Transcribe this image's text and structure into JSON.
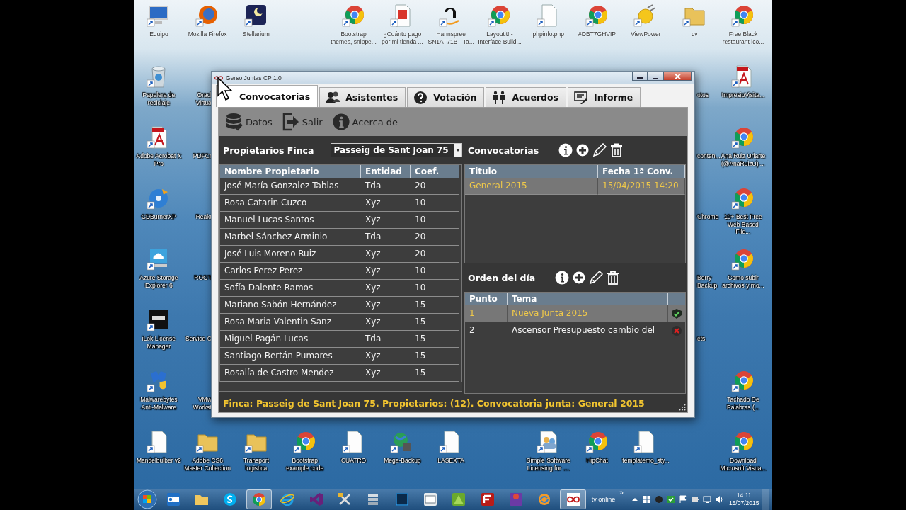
{
  "desktop": {
    "top_row": [
      {
        "label": "Equipo",
        "kind": "computer"
      },
      {
        "label": "Mozilla Firefox",
        "kind": "firefox"
      },
      {
        "label": "Stellarium",
        "kind": "night-tile"
      },
      {
        "label": "Bootstrap themes, snippe...",
        "kind": "chrome"
      },
      {
        "label": "¿Cuánto pago por mi tienda ...",
        "kind": "e-page"
      },
      {
        "label": "Hannspree SN1AT71B - Ta...",
        "kind": "amazon"
      },
      {
        "label": "Layoutit! - Interface Build...",
        "kind": "chrome"
      },
      {
        "label": "phpinfo.php",
        "kind": "page"
      },
      {
        "label": "#DBT7GHVIP",
        "kind": "chrome"
      },
      {
        "label": "ViewPower",
        "kind": "plug"
      },
      {
        "label": "cv",
        "kind": "folder"
      },
      {
        "label": "Free Black restaurant ico...",
        "kind": "chrome"
      }
    ],
    "left_column": [
      {
        "label": "Papelera de reciclaje",
        "kind": "recycle"
      },
      {
        "label": "Adobe Acrobat X Pro",
        "kind": "pdf"
      },
      {
        "label": "CDBurnerXP",
        "kind": "disc"
      },
      {
        "label": "Azure Storage Explorer 6",
        "kind": "cloud"
      },
      {
        "label": "iLok License Manager",
        "kind": "dark-tile"
      },
      {
        "label": "Malwarebytes Anti-Malware",
        "kind": "shield"
      }
    ],
    "right_column": [
      {
        "label": "ImpresioVisita...",
        "kind": "pdf"
      },
      {
        "label": "Ana Ruiz Uriarte (@AnaRuizU) ...",
        "kind": "chrome"
      },
      {
        "label": "10+ Best Free Web Based File...",
        "kind": "chrome"
      },
      {
        "label": "Como subir archivos y mo...",
        "kind": "chrome"
      },
      {
        "label": "Tachado De Palabras (...",
        "kind": "chrome"
      }
    ],
    "bottom_row": [
      {
        "label": "Mandelbulber v2",
        "kind": "page"
      },
      {
        "label": "Adobe CS6 Master Collection",
        "kind": "folder"
      },
      {
        "label": "Transport logistica",
        "kind": "folder"
      },
      {
        "label": "Bootstrap example code",
        "kind": "chrome"
      },
      {
        "label": "CUATRO",
        "kind": "page"
      },
      {
        "label": "Mega-Backup",
        "kind": "globe"
      },
      {
        "label": "LASEXTA",
        "kind": "page"
      },
      {
        "label": "Simple Software Licensing for ....",
        "kind": "people"
      },
      {
        "label": "HipChat",
        "kind": "chrome"
      },
      {
        "label": "templatemo_sty...",
        "kind": "page"
      },
      {
        "label": "Download Microsoft Visua...",
        "kind": "chrome"
      }
    ],
    "covered_left": [
      {
        "lines": [
          "Oracl",
          "Virtua"
        ]
      },
      {
        "lines": [
          "PDFCr"
        ]
      },
      {
        "lines": [
          "Reakt"
        ]
      },
      {
        "lines": [
          "ROOT"
        ]
      },
      {
        "lines": [
          "Service C"
        ]
      },
      {
        "lines": [
          "VMw",
          "Workst"
        ]
      }
    ],
    "covered_right": [
      {
        "lines": [
          "otos"
        ]
      },
      {
        "lines": [
          "conten..."
        ]
      },
      {
        "lines": [
          "Chrome"
        ]
      },
      {
        "lines": [
          "Berry",
          "Backup"
        ]
      },
      {
        "lines": [
          "ets"
        ]
      }
    ]
  },
  "window": {
    "title": "Gerso Juntas CP 1.0",
    "tabs": [
      {
        "label": "Convocatorias",
        "kind": "plain",
        "selected": true
      },
      {
        "label": "Asistentes",
        "kind": "people",
        "selected": false
      },
      {
        "label": "Votación",
        "kind": "question",
        "selected": false
      },
      {
        "label": "Acuerdos",
        "kind": "couple",
        "selected": false
      },
      {
        "label": "Informe",
        "kind": "report",
        "selected": false
      }
    ],
    "toolbar": [
      {
        "label": "Datos",
        "kind": "database"
      },
      {
        "label": "Salir",
        "kind": "exit"
      },
      {
        "label": "Acerca de",
        "kind": "info"
      }
    ],
    "owners": {
      "label": "Propietarios Finca",
      "building": "Passeig de Sant Joan 75",
      "columns": [
        "Nombre Propietario",
        "Entidad",
        "Coef."
      ],
      "rows": [
        {
          "cells": [
            "José María Gonzalez Tablas",
            "Tda",
            "20"
          ],
          "selected": false
        },
        {
          "cells": [
            "Rosa Catarin Cuzco",
            "Xyz",
            "10"
          ],
          "selected": false
        },
        {
          "cells": [
            "Manuel Lucas Santos",
            "Xyz",
            "10"
          ],
          "selected": false
        },
        {
          "cells": [
            "Marbel Sánchez Arminio",
            "Tda",
            "20"
          ],
          "selected": false
        },
        {
          "cells": [
            "José Luis Moreno Ruiz",
            "Xyz",
            "20"
          ],
          "selected": false
        },
        {
          "cells": [
            "Carlos Perez Perez",
            "Xyz",
            "10"
          ],
          "selected": false
        },
        {
          "cells": [
            "Sofía Dalente Ramos",
            "Xyz",
            "10"
          ],
          "selected": false
        },
        {
          "cells": [
            "Mariano Sabón Hernández",
            "Xyz",
            "15"
          ],
          "selected": false
        },
        {
          "cells": [
            "Rosa Maria Valentin Sanz",
            "Xyz",
            "15"
          ],
          "selected": false
        },
        {
          "cells": [
            "Miguel Pagán Lucas",
            "Tda",
            "15"
          ],
          "selected": false
        },
        {
          "cells": [
            "Santiago Bertán Pumares",
            "Xyz",
            "15"
          ],
          "selected": false
        },
        {
          "cells": [
            "Rosalía de Castro Mendez",
            "Xyz",
            "15"
          ],
          "selected": false
        }
      ]
    },
    "calls": {
      "label": "Convocatorias",
      "columns": [
        "Titulo",
        "Fecha 1ª Conv."
      ],
      "rows": [
        {
          "cells": [
            "General 2015",
            "15/04/2015 14:20"
          ],
          "selected": true
        }
      ]
    },
    "agenda": {
      "label": "Orden del día",
      "columns": [
        "Punto",
        "Tema"
      ],
      "rows": [
        {
          "cells": [
            "1",
            "Nueva Junta 2015"
          ],
          "approved": true,
          "selected": true
        },
        {
          "cells": [
            "2",
            "Ascensor Presupuesto cambio del"
          ],
          "approved": false,
          "selected": false
        }
      ]
    },
    "status_bar": "Finca: Passeig de Sant Joan 75. Propietarios: (12). Convocatoria junta: General 2015"
  },
  "taskbar": {
    "items": [
      {
        "kind": "outlook",
        "active": false
      },
      {
        "kind": "explorer",
        "active": false
      },
      {
        "kind": "skype",
        "active": false
      },
      {
        "kind": "chrome",
        "active": true
      },
      {
        "kind": "ie",
        "active": false
      },
      {
        "kind": "vs",
        "active": false
      },
      {
        "kind": "tool",
        "active": false
      },
      {
        "kind": "stack",
        "active": false
      },
      {
        "kind": "ps",
        "active": false
      },
      {
        "kind": "window",
        "active": false
      },
      {
        "kind": "green",
        "active": false
      },
      {
        "kind": "filezilla",
        "active": false
      },
      {
        "kind": "purple",
        "active": false
      },
      {
        "kind": "sync",
        "active": false
      },
      {
        "kind": "infinity",
        "active": true
      }
    ],
    "toolbar_label": "tv online",
    "toolbar_more": "»",
    "time": "14:11",
    "date": "15/07/2015"
  }
}
